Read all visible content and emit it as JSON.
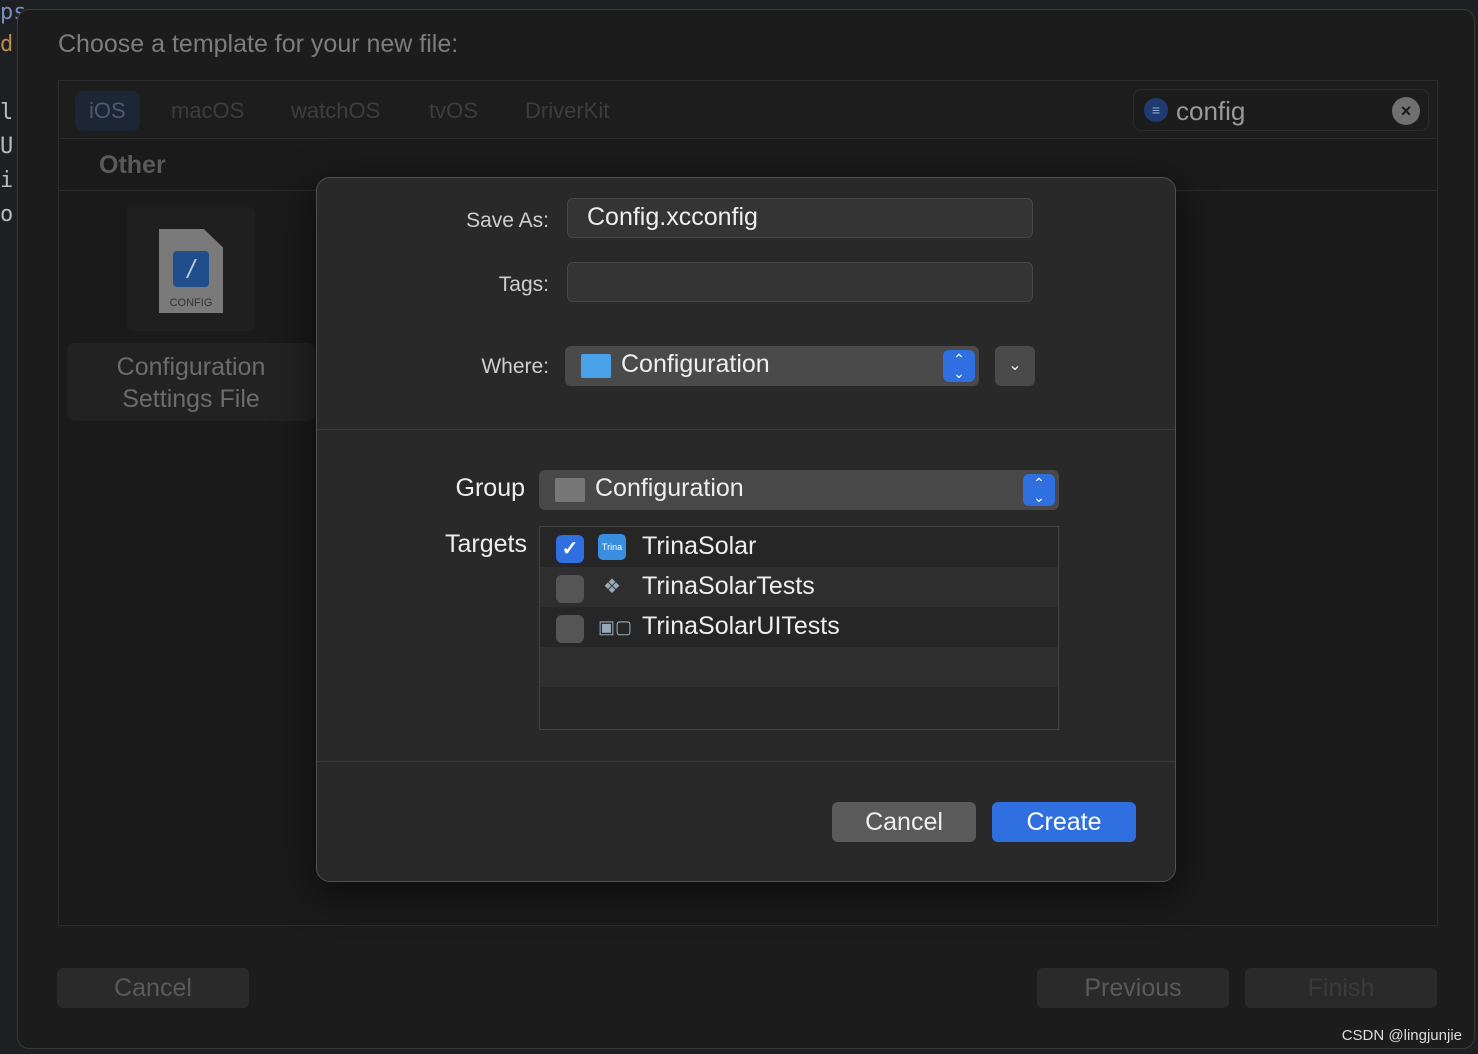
{
  "background_code": [
    "ps",
    "d",
    "l",
    "U",
    "i",
    "o"
  ],
  "dialog": {
    "title": "Choose a template for your new file:",
    "tabs": [
      "iOS",
      "macOS",
      "watchOS",
      "tvOS",
      "DriverKit"
    ],
    "selected_tab": "iOS",
    "search": {
      "value": "config",
      "filter_icon": "filter-icon",
      "clear_icon": "clear-icon"
    },
    "section": "Other",
    "template": {
      "icon_label": "CONFIG",
      "name_line1": "Configuration",
      "name_line2": "Settings File"
    },
    "buttons": {
      "cancel": "Cancel",
      "previous": "Previous",
      "finish": "Finish"
    }
  },
  "save_sheet": {
    "save_as_label": "Save As:",
    "save_as_value": "Config.xcconfig",
    "tags_label": "Tags:",
    "tags_value": "",
    "where_label": "Where:",
    "where_value": "Configuration",
    "group_label": "Group",
    "group_value": "Configuration",
    "targets_label": "Targets",
    "targets": [
      {
        "name": "TrinaSolar",
        "checked": true,
        "icon": "app-icon"
      },
      {
        "name": "TrinaSolarTests",
        "checked": false,
        "icon": "unit-tests-icon"
      },
      {
        "name": "TrinaSolarUITests",
        "checked": false,
        "icon": "ui-tests-icon"
      }
    ],
    "cancel": "Cancel",
    "create": "Create",
    "accent": "#2f6fe0"
  },
  "watermark": "CSDN @lingjunjie"
}
